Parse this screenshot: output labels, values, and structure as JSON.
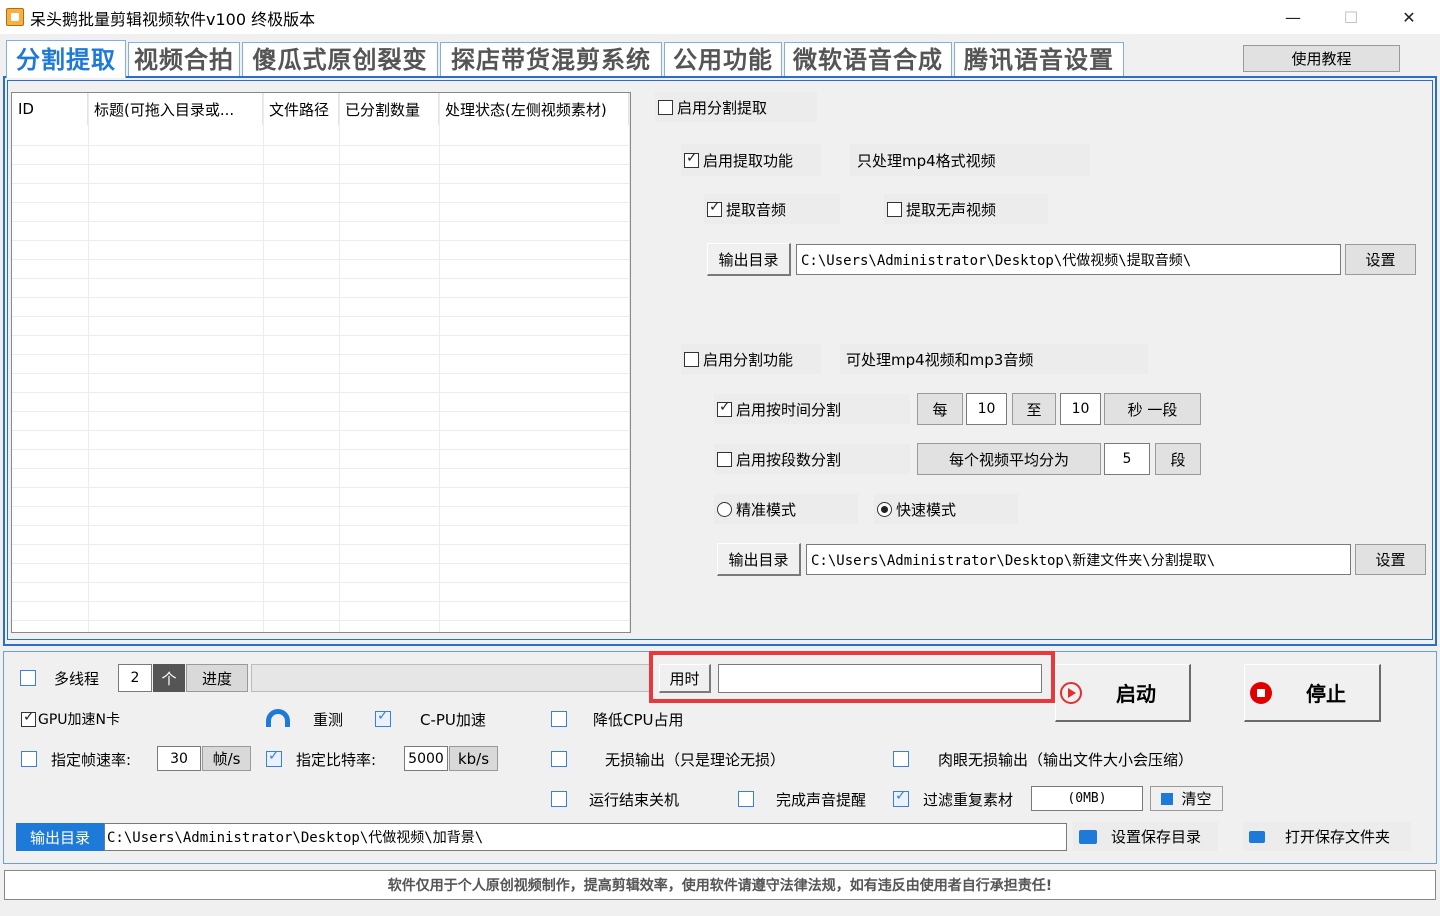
{
  "window": {
    "title": "呆头鹅批量剪辑视频软件v100 终极版本",
    "minimize": "—",
    "maximize": "☐",
    "close": "✕"
  },
  "tabs": [
    {
      "label": "分割提取",
      "active": true
    },
    {
      "label": "视频合拍",
      "active": false
    },
    {
      "label": "傻瓜式原创裂变",
      "active": false
    },
    {
      "label": "探店带货混剪系统",
      "active": false
    },
    {
      "label": "公用功能",
      "active": false
    },
    {
      "label": "微软语音合成",
      "active": false
    },
    {
      "label": "腾讯语音设置",
      "active": false
    }
  ],
  "help_button": "使用教程",
  "table": {
    "columns": [
      "ID",
      "标题(可拖入目录或...",
      "文件路径",
      "已分割数量",
      "处理状态(左侧视频素材)"
    ],
    "rows": []
  },
  "extract": {
    "enable_split_extract": {
      "label": "启用分割提取",
      "checked": false
    },
    "enable_extract": {
      "label": "启用提取功能",
      "checked": true
    },
    "extract_note": "只处理mp4格式视频",
    "extract_audio": {
      "label": "提取音频",
      "checked": true
    },
    "extract_silent": {
      "label": "提取无声视频",
      "checked": false
    },
    "output_dir_label": "输出目录",
    "output_dir_value": "C:\\Users\\Administrator\\Desktop\\代做视频\\提取音频\\",
    "set_button": "设置"
  },
  "split": {
    "enable_split": {
      "label": "启用分割功能",
      "checked": false
    },
    "split_note": "可处理mp4视频和mp3音频",
    "by_time": {
      "label": "启用按时间分割",
      "checked": true
    },
    "every": "每",
    "from_value": "10",
    "to": "至",
    "to_value": "10",
    "seconds_segment": "秒 一段",
    "by_count": {
      "label": "启用按段数分割",
      "checked": false
    },
    "avg_label": "每个视频平均分为",
    "segments_value": "5",
    "segment_unit": "段",
    "precise_mode": {
      "label": "精准模式",
      "selected": false
    },
    "fast_mode": {
      "label": "快速模式",
      "selected": true
    },
    "output_dir_label": "输出目录",
    "output_dir_value": "C:\\Users\\Administrator\\Desktop\\新建文件夹\\分割提取\\",
    "set_button": "设置"
  },
  "bottom": {
    "multithread": {
      "label": "多线程",
      "checked": false
    },
    "threads_value": "2",
    "threads_unit": "个",
    "progress_label": "进度",
    "progress": 0,
    "elapsed_label": "用时",
    "elapsed_value": "",
    "start_button": "启动",
    "stop_button": "停止",
    "gpu_accel": {
      "label": "GPU加速N卡",
      "checked": true
    },
    "retest": "重测",
    "cpu_accel": {
      "label": "C-PU加速",
      "checked": true
    },
    "reduce_cpu": {
      "label": "降低CPU占用",
      "checked": false
    },
    "frame_rate": {
      "label": "指定帧速率:",
      "checked": false
    },
    "frame_rate_value": "30",
    "frame_rate_unit": "帧/s",
    "bitrate": {
      "label": "指定比特率:",
      "checked": true
    },
    "bitrate_value": "5000",
    "bitrate_unit": "kb/s",
    "lossless": {
      "label": "无损输出（只是理论无损）",
      "checked": false
    },
    "visual_lossless": {
      "label": "肉眼无损输出（输出文件大小会压缩）",
      "checked": false
    },
    "shutdown": {
      "label": "运行结束关机",
      "checked": false
    },
    "sound_alert": {
      "label": "完成声音提醒",
      "checked": false
    },
    "filter_dup": {
      "label": "过滤重复素材",
      "checked": true
    },
    "filter_value": "(0MB)",
    "clear_button": "清空",
    "output_dir_label": "输出目录",
    "output_dir_value": "C:\\Users\\Administrator\\Desktop\\代做视频\\加背景\\",
    "set_save_dir": "设置保存目录",
    "open_save_dir": "打开保存文件夹"
  },
  "footer": "软件仅用于个人原创视频制作，提高剪辑效率，使用软件请遵守法律法规，如有违反由使用者自行承担责任!",
  "colors": {
    "accent": "#1e7ad8",
    "highlight": "#e8383c",
    "start_icon": "#e03030",
    "stop_icon": "#e00000"
  }
}
